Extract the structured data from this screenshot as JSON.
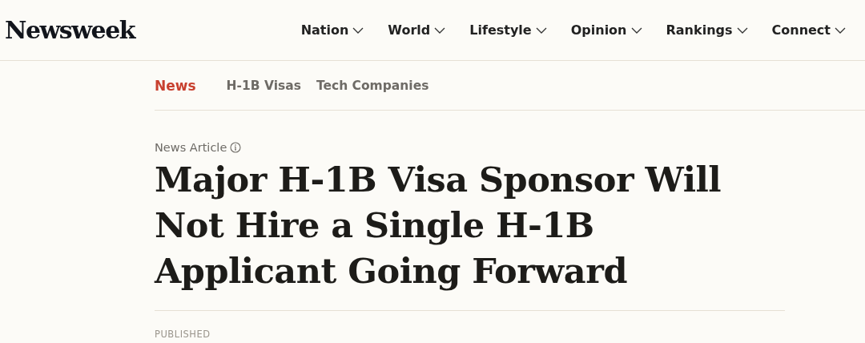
{
  "logo": "Newsweek",
  "nav": [
    {
      "label": "Nation"
    },
    {
      "label": "World"
    },
    {
      "label": "Lifestyle"
    },
    {
      "label": "Opinion"
    },
    {
      "label": "Rankings"
    },
    {
      "label": "Connect"
    }
  ],
  "subnav": [
    {
      "label": "News",
      "kind": "category"
    },
    {
      "label": "H-1B Visas",
      "kind": "tag"
    },
    {
      "label": "Tech Companies",
      "kind": "tag"
    }
  ],
  "article": {
    "type_label": "News Article",
    "headline": "Major H-1B Visa Sponsor Will Not Hire a Single H-1B Applicant Going Forward",
    "published_label": "PUBLISHED"
  }
}
